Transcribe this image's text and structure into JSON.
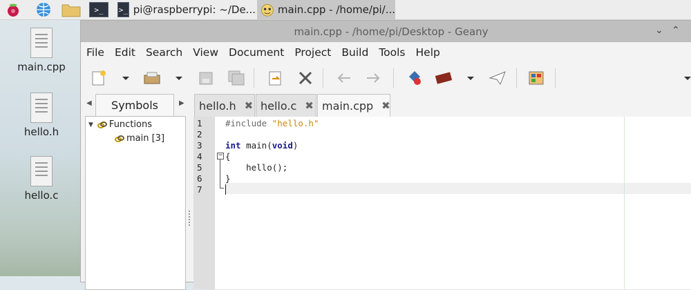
{
  "taskbar": {
    "launcher_icons": [
      "raspberry-icon",
      "globe-icon",
      "folder-icon",
      "terminal-icon"
    ],
    "tasks": [
      {
        "label": "pi@raspberrypi: ~/De..."
      },
      {
        "label": "main.cpp - /home/pi/..."
      }
    ]
  },
  "desktop": {
    "icons": [
      {
        "label": "main.cpp"
      },
      {
        "label": "hello.h"
      },
      {
        "label": "hello.c"
      }
    ]
  },
  "window": {
    "title": "main.cpp - /home/pi/Desktop - Geany",
    "menu": [
      "File",
      "Edit",
      "Search",
      "View",
      "Document",
      "Project",
      "Build",
      "Tools",
      "Help"
    ]
  },
  "sidebar": {
    "tab_label": "Symbols",
    "tree": {
      "group": "Functions",
      "item": "main [3]"
    }
  },
  "editor": {
    "tabs": [
      {
        "label": "hello.h",
        "active": false
      },
      {
        "label": "hello.c",
        "active": false
      },
      {
        "label": "main.cpp",
        "active": true
      }
    ],
    "line_numbers": [
      "1",
      "2",
      "3",
      "4",
      "5",
      "6",
      "7"
    ],
    "code": {
      "l1_directive": "#include",
      "l1_header": "\"hello.h\"",
      "l3_type": "int",
      "l3_name": "main(",
      "l3_param": "void",
      "l3_close": ")",
      "l4": "{",
      "l5": "    hello();",
      "l6": "}"
    }
  },
  "colors": {
    "keyword": "#1a1a8c",
    "string": "#c78a00",
    "titlebar": "#bfbfbf"
  }
}
